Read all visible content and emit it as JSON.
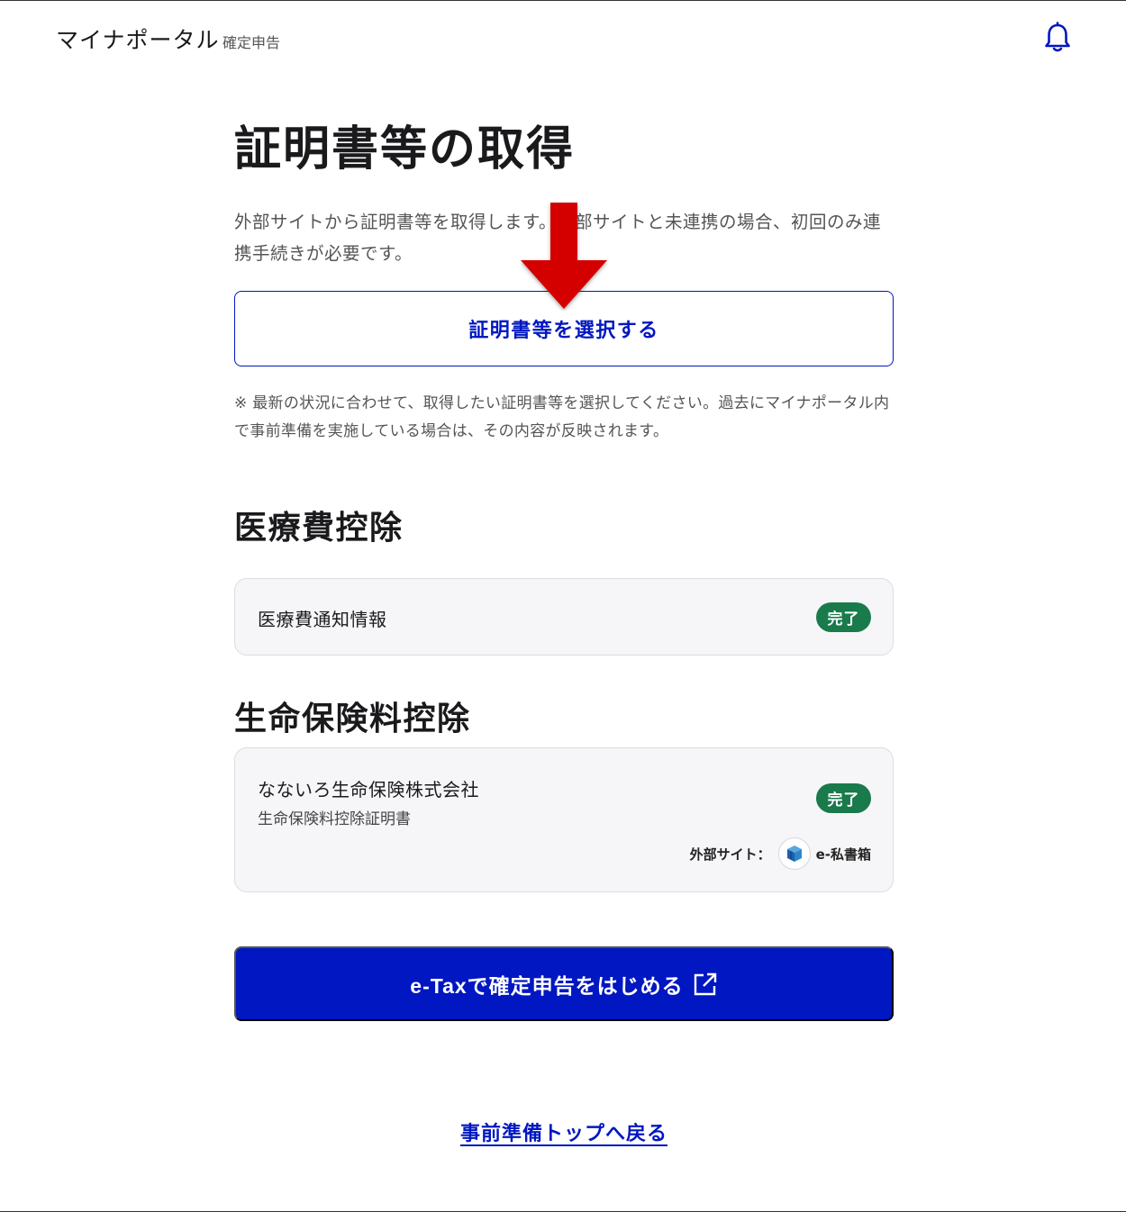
{
  "header": {
    "brand": "マイナポータル",
    "section": "確定申告",
    "bell_icon": "bell-icon"
  },
  "main": {
    "title": "証明書等の取得",
    "intro": "外部サイトから証明書等を取得します。外部サイトと未連携の場合、初回のみ連携手続きが必要です。",
    "select_button": "証明書等を選択する",
    "note": "※ 最新の状況に合わせて、取得したい証明書等を選択してください。過去にマイナポータル内で事前準備を実施している場合は、その内容が反映されます。"
  },
  "sections": [
    {
      "title": "医療費控除",
      "items": [
        {
          "name": "医療費通知情報",
          "status": "完了"
        }
      ]
    },
    {
      "title": "生命保険料控除",
      "items": [
        {
          "name": "なないろ生命保険株式会社",
          "subtitle": "生命保険料控除証明書",
          "status": "完了",
          "external_label": "外部サイト：",
          "external_name": "e-私書箱"
        }
      ]
    }
  ],
  "actions": {
    "etax_button": "e-Taxで確定申告をはじめる",
    "back_link": "事前準備トップへ戻る"
  },
  "colors": {
    "primary": "#0017c1",
    "success": "#197a4b",
    "annotation_arrow": "#d40000"
  }
}
